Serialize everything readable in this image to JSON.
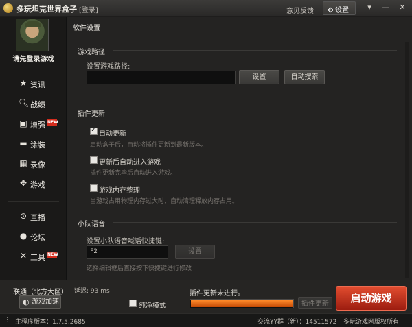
{
  "titlebar": {
    "app_title": "多玩坦克世界盒子",
    "login_link": "[登录]",
    "feedback": "意见反馈",
    "settings": "设置"
  },
  "sidebar": {
    "login_prompt": "请先登录游戏",
    "items": [
      {
        "label": "资讯",
        "icon": "star-icon"
      },
      {
        "label": "战绩",
        "icon": "magnifier-icon"
      },
      {
        "label": "增强",
        "icon": "toolbox-icon",
        "badge": "NEW"
      },
      {
        "label": "涂装",
        "icon": "tank-icon"
      },
      {
        "label": "录像",
        "icon": "film-icon"
      },
      {
        "label": "游戏",
        "icon": "gamepad-icon"
      },
      {
        "label": "直播",
        "icon": "play-circle-icon"
      },
      {
        "label": "论坛",
        "icon": "chat-icon"
      },
      {
        "label": "工具",
        "icon": "tools-icon",
        "badge": "NEW"
      }
    ]
  },
  "settings_panel": {
    "title": "软件设置",
    "game_path": {
      "section": "游戏路径",
      "field_label": "设置游戏路径:",
      "value": "",
      "set_button": "设置",
      "auto_search_button": "自动搜索"
    },
    "plugin_update": {
      "section": "插件更新",
      "options": [
        {
          "label": "自动更新",
          "checked": true,
          "hint": "启动盒子后，自动将插件更新到最新版本。"
        },
        {
          "label": "更新后自动进入游戏",
          "checked": false,
          "hint": "插件更新完毕后自动进入游戏。"
        },
        {
          "label": "游戏内存整理",
          "checked": false,
          "hint": "当游戏占用物理内存过大时，自动清理释放内存占用。"
        }
      ]
    },
    "team_voice": {
      "section": "小队语音",
      "field_label": "设置小队语音喊话快捷键:",
      "hotkey_value": "F2",
      "set_button": "设置",
      "hint": "选择编辑框后直接按下快捷键进行修改"
    }
  },
  "bottom": {
    "region": "联通（北方大区）",
    "latency": "延迟: 93 ms",
    "accelerate_button": "游戏加速",
    "pure_mode": "纯净模式",
    "pure_mode_checked": false,
    "update_status": "插件更新未进行。",
    "update_progress": 1.0,
    "update_button": "插件更新",
    "launch_button": "启动游戏"
  },
  "statusbar": {
    "version": "主程序版本：1.7.5.2685",
    "qq_group": "交流YY群（新）：14511572",
    "copyright": "多玩游戏网版权所有"
  },
  "colors": {
    "accent_red": "#c9311a",
    "progress_orange": "#f07020",
    "badge_red": "#d42d1e"
  }
}
